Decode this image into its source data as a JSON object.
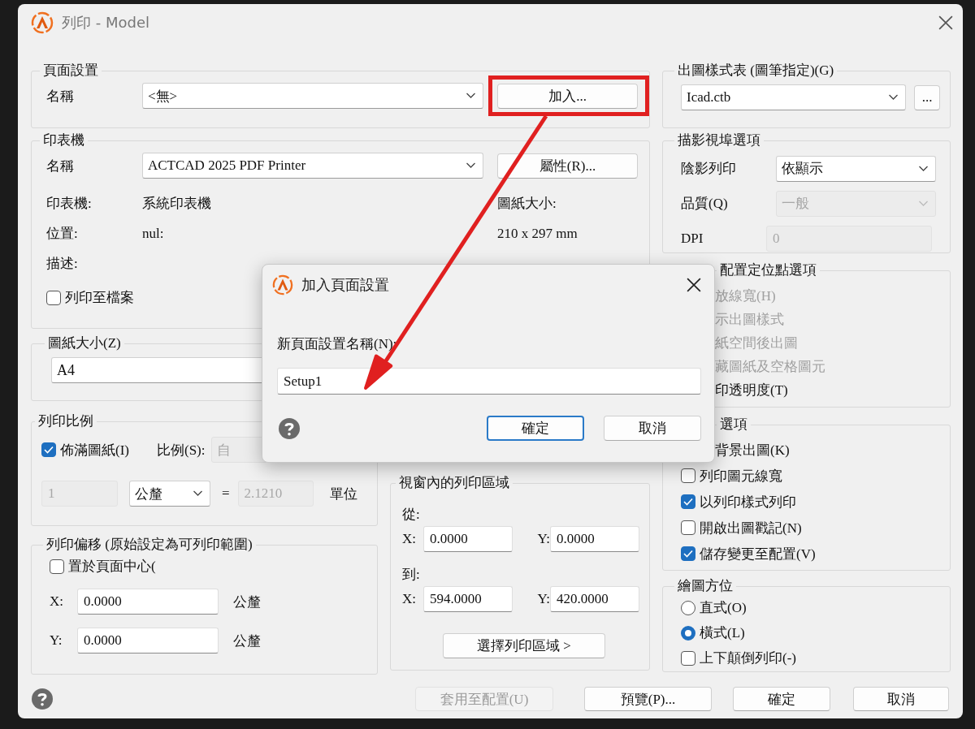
{
  "window": {
    "title": "列印 - Model"
  },
  "page_setup": {
    "title": "頁面設置",
    "name_label": "名稱",
    "name_value": "<無>",
    "add_button": "加入..."
  },
  "printer": {
    "title": "印表機",
    "name_label": "名稱",
    "name_value": "ACTCAD 2025 PDF Printer",
    "properties_button": "屬性(R)...",
    "info": [
      {
        "label": "印表機:",
        "value": "系統印表機"
      },
      {
        "label": "位置:",
        "value": "nul:"
      },
      {
        "label": "描述:"
      }
    ],
    "paper_size_label": "圖紙大小:",
    "paper_size_value": "210 x 297 mm",
    "print_to_file": {
      "label": "列印至檔案",
      "checked": false
    }
  },
  "paper_size": {
    "title": "圖紙大小(Z)",
    "value": "A4"
  },
  "scale": {
    "title": "列印比例",
    "fit": {
      "label": "佈滿圖紙(I)",
      "checked": true
    },
    "scale_label": "比例(S):",
    "scale_value": "自",
    "left_value": "1",
    "unit": "公釐",
    "equals": "=",
    "right_value": "2.1210",
    "units_label": "單位"
  },
  "offset": {
    "title": "列印偏移 (原始設定為可列印範圍)",
    "center": {
      "label": "置於頁面中心(",
      "checked": false
    },
    "fields": [
      {
        "label": "X:",
        "value": "0.0000",
        "unit": "公釐"
      },
      {
        "label": "Y:",
        "value": "0.0000",
        "unit": "公釐"
      }
    ]
  },
  "viewport_area": {
    "title": "視窗內的列印區域",
    "from_label": "從:",
    "from": [
      {
        "label": "X:",
        "value": "0.0000"
      },
      {
        "label": "Y:",
        "value": "0.0000"
      }
    ],
    "to_label": "到:",
    "to": [
      {
        "label": "X:",
        "value": "594.0000"
      },
      {
        "label": "Y:",
        "value": "420.0000"
      }
    ],
    "select_button": "選擇列印區域 >"
  },
  "plot_style_table": {
    "title": "出圖樣式表 (圖筆指定)(G)",
    "value": "Icad.ctb",
    "edit_button": "..."
  },
  "shaded_viewport": {
    "title": "描影視埠選項",
    "rows": [
      {
        "kind": "select",
        "label": "陰影列印",
        "value": "依顯示",
        "disabled": false
      },
      {
        "kind": "select",
        "label": "品質(Q)",
        "value": "一般",
        "disabled": true
      },
      {
        "kind": "input",
        "label": "DPI",
        "value": "0",
        "disabled": true
      }
    ]
  },
  "layout_options": {
    "title": "配置定位點選項",
    "items": [
      {
        "label": "放線寬(H)",
        "disabled": true
      },
      {
        "label": "示出圖樣式",
        "disabled": true
      },
      {
        "label": "紙空間後出圖",
        "disabled": true
      },
      {
        "label": "藏圖紙及空格圖元",
        "disabled": true
      },
      {
        "label": "印透明度(T)",
        "disabled": false
      }
    ]
  },
  "plot_options": {
    "title": "選項",
    "items": [
      {
        "kind": "text",
        "label": "背景出圖(K)"
      },
      {
        "kind": "checkbox",
        "label": "列印圖元線寬",
        "checked": false
      },
      {
        "kind": "checkbox",
        "label": "以列印樣式列印",
        "checked": true
      },
      {
        "kind": "checkbox",
        "label": "開啟出圖戳記(N)",
        "checked": false
      },
      {
        "kind": "checkbox",
        "label": "儲存變更至配置(V)",
        "checked": true
      }
    ]
  },
  "orientation": {
    "title": "繪圖方位",
    "items": [
      {
        "kind": "radio",
        "label": "直式(O)",
        "selected": false
      },
      {
        "kind": "radio",
        "label": "橫式(L)",
        "selected": true
      },
      {
        "kind": "checkbox",
        "label": "上下顛倒列印(-)",
        "checked": false
      }
    ]
  },
  "footer": {
    "buttons": [
      {
        "label": "套用至配置(U)",
        "disabled": true
      },
      {
        "label": "預覽(P)...",
        "disabled": false
      },
      {
        "label": "確定",
        "disabled": false
      },
      {
        "label": "取消",
        "disabled": false
      }
    ]
  },
  "add_page_setup_dialog": {
    "title": "加入頁面設置",
    "prompt": "新頁面設置名稱(N):",
    "value": "Setup1",
    "buttons": [
      {
        "label": "確定",
        "default": true
      },
      {
        "label": "取消",
        "default": false
      }
    ]
  }
}
